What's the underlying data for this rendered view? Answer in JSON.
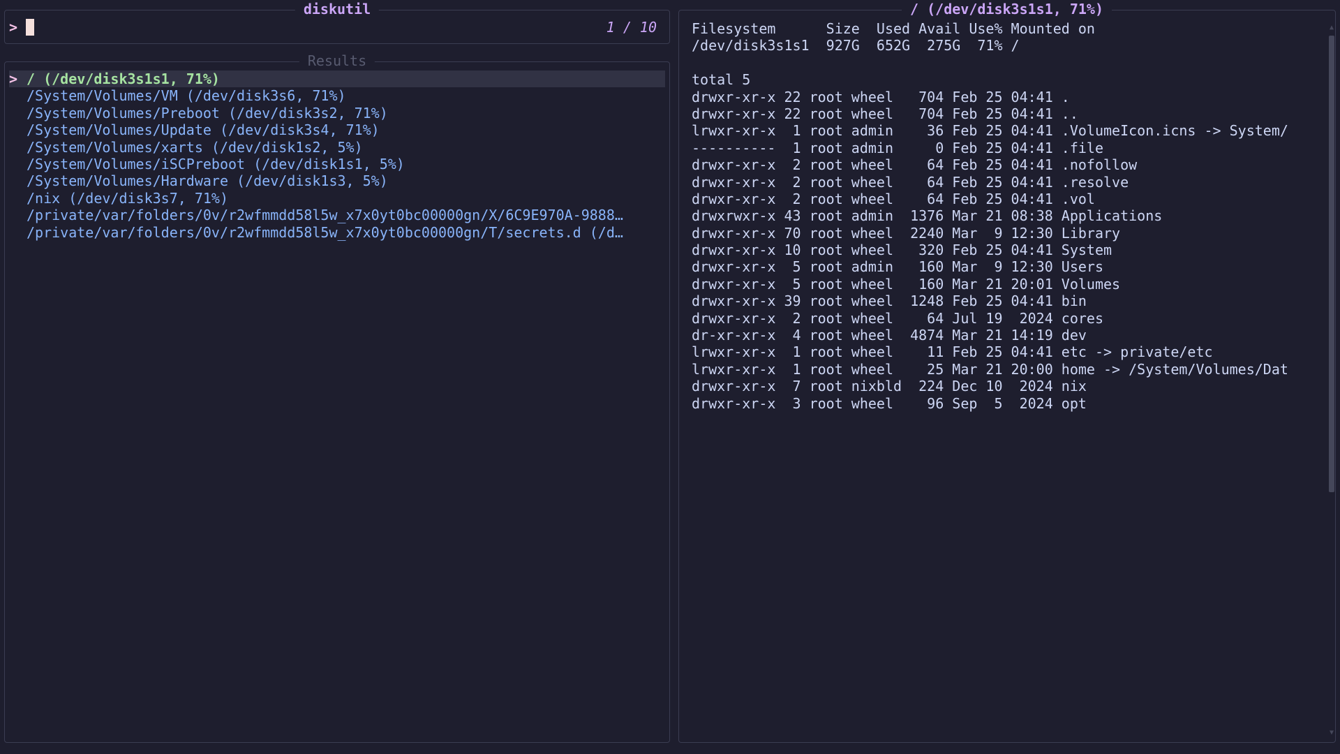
{
  "input": {
    "title": "diskutil",
    "prompt": ">",
    "counter": "1 / 10"
  },
  "results": {
    "title": "Results",
    "selected_mark": ">",
    "items": [
      "/ (/dev/disk3s1s1, 71%)",
      "/System/Volumes/VM (/dev/disk3s6, 71%)",
      "/System/Volumes/Preboot (/dev/disk3s2, 71%)",
      "/System/Volumes/Update (/dev/disk3s4, 71%)",
      "/System/Volumes/xarts (/dev/disk1s2, 5%)",
      "/System/Volumes/iSCPreboot (/dev/disk1s1, 5%)",
      "/System/Volumes/Hardware (/dev/disk1s3, 5%)",
      "/nix (/dev/disk3s7, 71%)",
      "/private/var/folders/0v/r2wfmmdd58l5w_x7x0yt0bc00000gn/X/6C9E970A-9888…",
      "/private/var/folders/0v/r2wfmmdd58l5w_x7x0yt0bc00000gn/T/secrets.d (/d…"
    ]
  },
  "preview": {
    "title": "/ (/dev/disk3s1s1, 71%)",
    "lines": [
      "Filesystem      Size  Used Avail Use% Mounted on",
      "/dev/disk3s1s1  927G  652G  275G  71% /",
      "",
      "total 5",
      "drwxr-xr-x 22 root wheel   704 Feb 25 04:41 .",
      "drwxr-xr-x 22 root wheel   704 Feb 25 04:41 ..",
      "lrwxr-xr-x  1 root admin    36 Feb 25 04:41 .VolumeIcon.icns -> System/",
      "----------  1 root admin     0 Feb 25 04:41 .file",
      "drwxr-xr-x  2 root wheel    64 Feb 25 04:41 .nofollow",
      "drwxr-xr-x  2 root wheel    64 Feb 25 04:41 .resolve",
      "drwxr-xr-x  2 root wheel    64 Feb 25 04:41 .vol",
      "drwxrwxr-x 43 root admin  1376 Mar 21 08:38 Applications",
      "drwxr-xr-x 70 root wheel  2240 Mar  9 12:30 Library",
      "drwxr-xr-x 10 root wheel   320 Feb 25 04:41 System",
      "drwxr-xr-x  5 root admin   160 Mar  9 12:30 Users",
      "drwxr-xr-x  5 root wheel   160 Mar 21 20:01 Volumes",
      "drwxr-xr-x 39 root wheel  1248 Feb 25 04:41 bin",
      "drwxr-xr-x  2 root wheel    64 Jul 19  2024 cores",
      "dr-xr-xr-x  4 root wheel  4874 Mar 21 14:19 dev",
      "lrwxr-xr-x  1 root wheel    11 Feb 25 04:41 etc -> private/etc",
      "lrwxr-xr-x  1 root wheel    25 Mar 21 20:00 home -> /System/Volumes/Dat",
      "drwxr-xr-x  7 root nixbld  224 Dec 10  2024 nix",
      "drwxr-xr-x  3 root wheel    96 Sep  5  2024 opt"
    ]
  },
  "colors": {
    "background": "#1e1e2e",
    "border": "#3b3d52",
    "accent": "#cba6f7",
    "selected_text": "#a6e3a1",
    "result_text": "#89b4fa",
    "pointer": "#f5c2e7"
  }
}
